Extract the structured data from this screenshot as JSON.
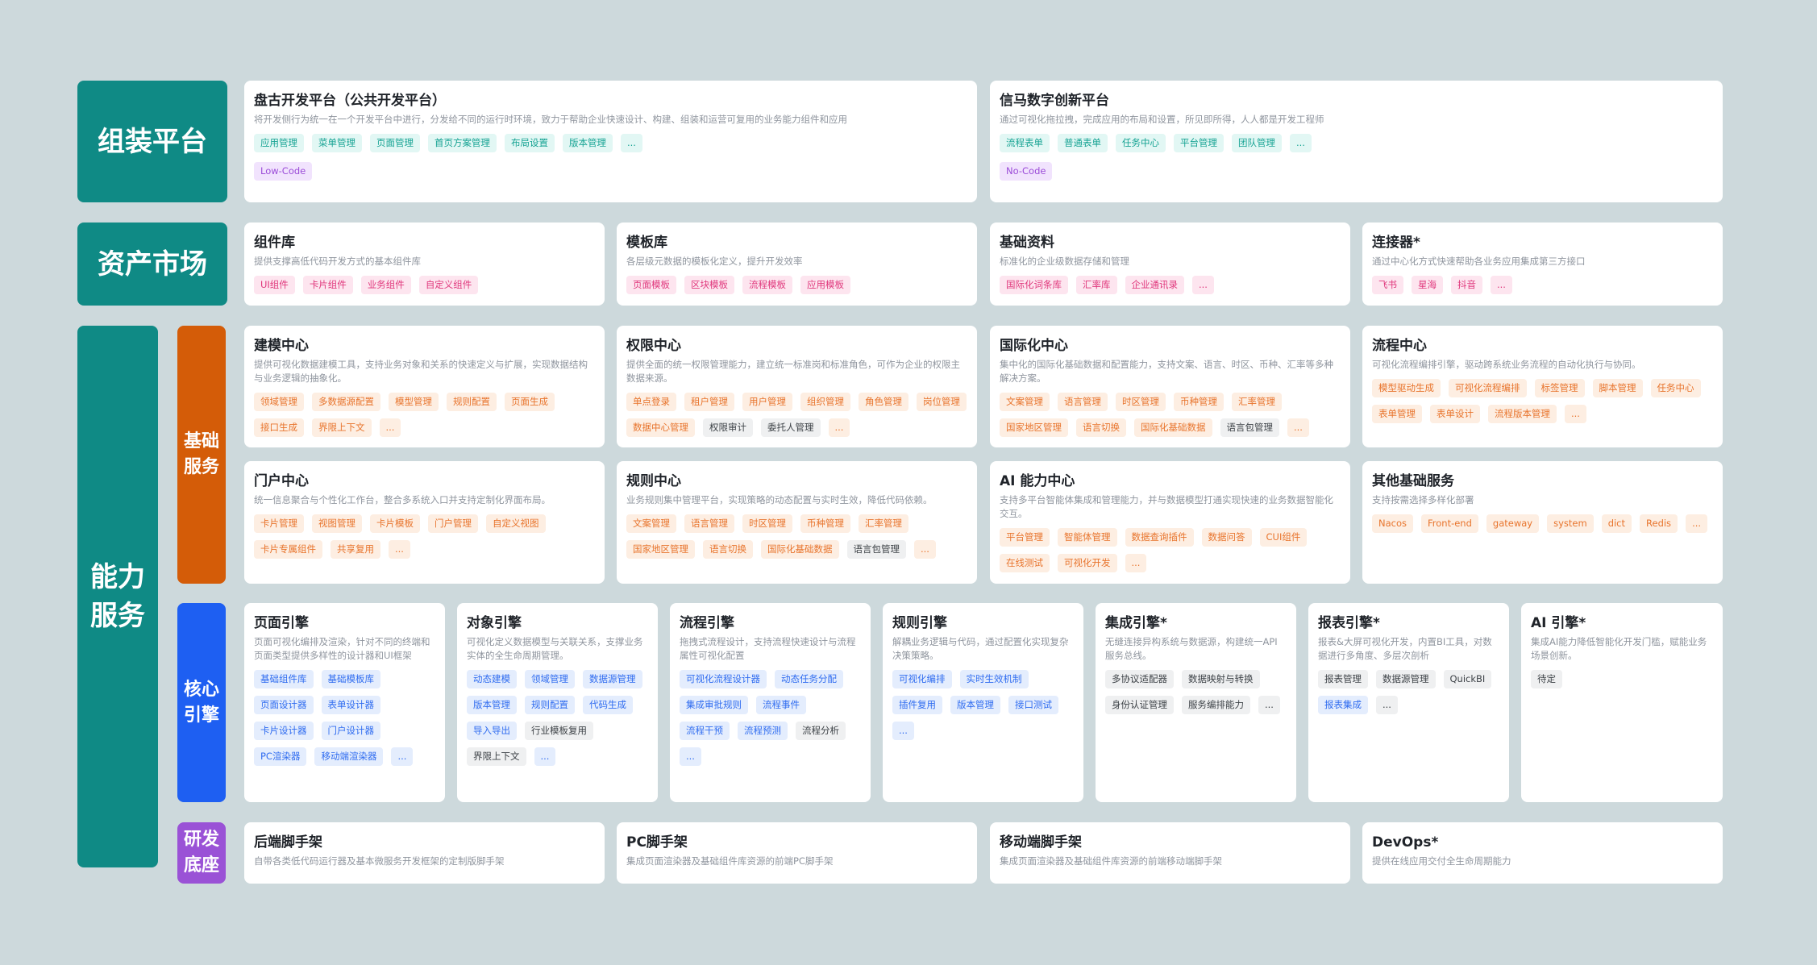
{
  "colors": {
    "teal": "#0f8a85",
    "orange": "#d45c08",
    "blue": "#1e5ff2",
    "purple": "#9a52d6",
    "background": "#cdd9dc"
  },
  "sections": {
    "assembly": "组装平台",
    "assets": "资产市场",
    "capability": "能力\n服务",
    "basic": "基础\n服务",
    "core": "核心\n引擎",
    "foundation": "研发\n底座"
  },
  "cards": {
    "pangu": {
      "title": "盘古开发平台（公共开发平台）",
      "desc": "将开发侧行为统一在一个开发平台中进行，分发给不同的运行时环境，致力于帮助企业快速设计、构建、组装和运营可复用的业务能力组件和应用",
      "tags": [
        {
          "text": "应用管理",
          "c": "teal"
        },
        {
          "text": "菜单管理",
          "c": "teal"
        },
        {
          "text": "页面管理",
          "c": "teal"
        },
        {
          "text": "首页方案管理",
          "c": "teal"
        },
        {
          "text": "布局设置",
          "c": "teal"
        },
        {
          "text": "版本管理",
          "c": "teal"
        },
        {
          "text": "...",
          "c": "teal"
        }
      ],
      "tags2": [
        {
          "text": "Low-Code",
          "c": "purple"
        }
      ]
    },
    "xinma": {
      "title": "信马数字创新平台",
      "desc": "通过可视化拖拉拽，完成应用的布局和设置，所见即所得，人人都是开发工程师",
      "tags": [
        {
          "text": "流程表单",
          "c": "teal"
        },
        {
          "text": "普通表单",
          "c": "teal"
        },
        {
          "text": "任务中心",
          "c": "teal"
        },
        {
          "text": "平台管理",
          "c": "teal"
        },
        {
          "text": "团队管理",
          "c": "teal"
        },
        {
          "text": "...",
          "c": "teal"
        }
      ],
      "tags2": [
        {
          "text": "No-Code",
          "c": "purple"
        }
      ]
    },
    "component": {
      "title": "组件库",
      "desc": "提供支撑高低代码开发方式的基本组件库",
      "tags": [
        {
          "text": "UI组件",
          "c": "pink"
        },
        {
          "text": "卡片组件",
          "c": "pink"
        },
        {
          "text": "业务组件",
          "c": "pink"
        },
        {
          "text": "自定义组件",
          "c": "pink"
        }
      ]
    },
    "template": {
      "title": "模板库",
      "desc": "各层级元数据的模板化定义，提升开发效率",
      "tags": [
        {
          "text": "页面模板",
          "c": "pink"
        },
        {
          "text": "区块模板",
          "c": "pink"
        },
        {
          "text": "流程模板",
          "c": "pink"
        },
        {
          "text": "应用模板",
          "c": "pink"
        }
      ]
    },
    "basedata": {
      "title": "基础资料",
      "desc": "标准化的企业级数据存储和管理",
      "tags": [
        {
          "text": "国际化词条库",
          "c": "pink"
        },
        {
          "text": "汇率库",
          "c": "pink"
        },
        {
          "text": "企业通讯录",
          "c": "pink"
        },
        {
          "text": "...",
          "c": "pink"
        }
      ]
    },
    "connector": {
      "title": "连接器*",
      "desc": "通过中心化方式快速帮助各业务应用集成第三方接口",
      "tags": [
        {
          "text": "飞书",
          "c": "pink"
        },
        {
          "text": "星海",
          "c": "pink"
        },
        {
          "text": "抖音",
          "c": "pink"
        },
        {
          "text": "...",
          "c": "pink"
        }
      ]
    },
    "modeling": {
      "title": "建模中心",
      "desc": "提供可视化数据建模工具，支持业务对象和关系的快速定义与扩展，实现数据结构与业务逻辑的抽象化。",
      "tags": [
        {
          "text": "领域管理",
          "c": "orange"
        },
        {
          "text": "多数据源配置",
          "c": "orange"
        },
        {
          "text": "模型管理",
          "c": "orange"
        },
        {
          "text": "规则配置",
          "c": "orange"
        },
        {
          "text": "页面生成",
          "c": "orange"
        },
        {
          "text": "接口生成",
          "c": "orange"
        },
        {
          "text": "界限上下文",
          "c": "orange"
        },
        {
          "text": "...",
          "c": "orange"
        }
      ]
    },
    "permission": {
      "title": "权限中心",
      "desc": "提供全面的统一权限管理能力，建立统一标准岗和标准角色，可作为企业的权限主数据来源。",
      "tags": [
        {
          "text": "单点登录",
          "c": "orange"
        },
        {
          "text": "租户管理",
          "c": "orange"
        },
        {
          "text": "用户管理",
          "c": "orange"
        },
        {
          "text": "组织管理",
          "c": "orange"
        },
        {
          "text": "角色管理",
          "c": "orange"
        },
        {
          "text": "岗位管理",
          "c": "orange"
        },
        {
          "text": "数据中心管理",
          "c": "orange"
        },
        {
          "text": "权限审计",
          "c": "gray"
        },
        {
          "text": "委托人管理",
          "c": "gray"
        },
        {
          "text": "...",
          "c": "orange"
        }
      ]
    },
    "i18n": {
      "title": "国际化中心",
      "desc": "集中化的国际化基础数据和配置能力，支持文案、语言、时区、币种、汇率等多种解决方案。",
      "tags": [
        {
          "text": "文案管理",
          "c": "orange"
        },
        {
          "text": "语言管理",
          "c": "orange"
        },
        {
          "text": "时区管理",
          "c": "orange"
        },
        {
          "text": "币种管理",
          "c": "orange"
        },
        {
          "text": "汇率管理",
          "c": "orange"
        },
        {
          "text": "国家地区管理",
          "c": "orange"
        },
        {
          "text": "语言切换",
          "c": "orange"
        },
        {
          "text": "国际化基础数据",
          "c": "orange"
        },
        {
          "text": "语言包管理",
          "c": "gray"
        },
        {
          "text": "...",
          "c": "orange"
        }
      ]
    },
    "process": {
      "title": "流程中心",
      "desc": "可视化流程编排引擎，驱动跨系统业务流程的自动化执行与协同。",
      "tags": [
        {
          "text": "模型驱动生成",
          "c": "orange"
        },
        {
          "text": "可视化流程编排",
          "c": "orange"
        },
        {
          "text": "标签管理",
          "c": "orange"
        },
        {
          "text": "脚本管理",
          "c": "orange"
        },
        {
          "text": "任务中心",
          "c": "orange"
        },
        {
          "text": "表单管理",
          "c": "orange"
        },
        {
          "text": "表单设计",
          "c": "orange"
        },
        {
          "text": "流程版本管理",
          "c": "orange"
        },
        {
          "text": "...",
          "c": "orange"
        }
      ]
    },
    "portal": {
      "title": "门户中心",
      "desc": "统一信息聚合与个性化工作台，整合多系统入口并支持定制化界面布局。",
      "tags": [
        {
          "text": "卡片管理",
          "c": "orange"
        },
        {
          "text": "视图管理",
          "c": "orange"
        },
        {
          "text": "卡片模板",
          "c": "orange"
        },
        {
          "text": "门户管理",
          "c": "orange"
        },
        {
          "text": "自定义视图",
          "c": "orange"
        },
        {
          "text": "卡片专属组件",
          "c": "orange"
        },
        {
          "text": "共享复用",
          "c": "orange"
        },
        {
          "text": "...",
          "c": "orange"
        }
      ]
    },
    "rules": {
      "title": "规则中心",
      "desc": "业务规则集中管理平台，实现策略的动态配置与实时生效，降低代码依赖。",
      "tags": [
        {
          "text": "文案管理",
          "c": "orange"
        },
        {
          "text": "语言管理",
          "c": "orange"
        },
        {
          "text": "时区管理",
          "c": "orange"
        },
        {
          "text": "币种管理",
          "c": "orange"
        },
        {
          "text": "汇率管理",
          "c": "orange"
        },
        {
          "text": "国家地区管理",
          "c": "orange"
        },
        {
          "text": "语言切换",
          "c": "orange"
        },
        {
          "text": "国际化基础数据",
          "c": "orange"
        },
        {
          "text": "语言包管理",
          "c": "gray"
        },
        {
          "text": "...",
          "c": "orange"
        }
      ]
    },
    "ai": {
      "title": "AI 能力中心",
      "desc": "支持多平台智能体集成和管理能力，并与数据模型打通实现快速的业务数据智能化交互。",
      "tags": [
        {
          "text": "平台管理",
          "c": "orange"
        },
        {
          "text": "智能体管理",
          "c": "orange"
        },
        {
          "text": "数据查询插件",
          "c": "orange"
        },
        {
          "text": "数据问答",
          "c": "orange"
        },
        {
          "text": "CUI组件",
          "c": "orange"
        },
        {
          "text": "在线测试",
          "c": "orange"
        },
        {
          "text": "可视化开发",
          "c": "orange"
        },
        {
          "text": "...",
          "c": "orange"
        }
      ]
    },
    "otherbasic": {
      "title": "其他基础服务",
      "desc": "支持按需选择多样化部署",
      "tags": [
        {
          "text": "Nacos",
          "c": "orange"
        },
        {
          "text": "Front-end",
          "c": "orange"
        },
        {
          "text": "gateway",
          "c": "orange"
        },
        {
          "text": "system",
          "c": "orange"
        },
        {
          "text": "dict",
          "c": "orange"
        },
        {
          "text": "Redis",
          "c": "orange"
        },
        {
          "text": "...",
          "c": "orange"
        }
      ]
    },
    "pageengine": {
      "title": "页面引擎",
      "desc": "页面可视化编排及渲染，针对不同的终端和页面类型提供多样性的设计器和UI框架",
      "tags": [
        {
          "text": "基础组件库",
          "c": "blue"
        },
        {
          "text": "基础模板库",
          "c": "blue"
        },
        {
          "text": "页面设计器",
          "c": "blue"
        },
        {
          "text": "表单设计器",
          "c": "blue"
        },
        {
          "text": "卡片设计器",
          "c": "blue"
        },
        {
          "text": "门户设计器",
          "c": "blue"
        },
        {
          "text": "PC渲染器",
          "c": "blue"
        },
        {
          "text": "移动端渲染器",
          "c": "blue"
        },
        {
          "text": "...",
          "c": "blue"
        }
      ]
    },
    "objectengine": {
      "title": "对象引擎",
      "desc": "可视化定义数据模型与关联关系，支撑业务实体的全生命周期管理。",
      "tags": [
        {
          "text": "动态建模",
          "c": "blue"
        },
        {
          "text": "领域管理",
          "c": "blue"
        },
        {
          "text": "数据源管理",
          "c": "blue"
        },
        {
          "text": "版本管理",
          "c": "blue"
        },
        {
          "text": "规则配置",
          "c": "blue"
        },
        {
          "text": "代码生成",
          "c": "blue"
        },
        {
          "text": "导入导出",
          "c": "blue"
        },
        {
          "text": "行业模板复用",
          "c": "gray"
        },
        {
          "text": "界限上下文",
          "c": "gray"
        },
        {
          "text": "...",
          "c": "blue"
        }
      ]
    },
    "flowengine": {
      "title": "流程引擎",
      "desc": "拖拽式流程设计，支持流程快速设计与流程属性可视化配置",
      "tags": [
        {
          "text": "可视化流程设计器",
          "c": "blue"
        },
        {
          "text": "动态任务分配",
          "c": "blue"
        },
        {
          "text": "集成审批规则",
          "c": "blue"
        },
        {
          "text": "流程事件",
          "c": "blue"
        },
        {
          "text": "流程干预",
          "c": "blue"
        },
        {
          "text": "流程预测",
          "c": "blue"
        },
        {
          "text": "流程分析",
          "c": "gray"
        },
        {
          "text": "...",
          "c": "blue"
        }
      ]
    },
    "ruleengine": {
      "title": "规则引擎",
      "desc": "解耦业务逻辑与代码，通过配置化实现复杂决策策略。",
      "tags": [
        {
          "text": "可视化编排",
          "c": "blue"
        },
        {
          "text": "实时生效机制",
          "c": "blue"
        },
        {
          "text": "插件复用",
          "c": "blue"
        },
        {
          "text": "版本管理",
          "c": "blue"
        },
        {
          "text": "接口测试",
          "c": "blue"
        },
        {
          "text": "...",
          "c": "blue"
        }
      ]
    },
    "integrationengine": {
      "title": "集成引擎*",
      "desc": "无缝连接异构系统与数据源，构建统一API服务总线。",
      "tags": [
        {
          "text": "多协议适配器",
          "c": "gray"
        },
        {
          "text": "数据映射与转换",
          "c": "gray"
        },
        {
          "text": "身份认证管理",
          "c": "gray"
        },
        {
          "text": "服务编排能力",
          "c": "gray"
        },
        {
          "text": "...",
          "c": "gray"
        }
      ]
    },
    "reportengine": {
      "title": "报表引擎*",
      "desc": "报表&大屏可视化开发，内置BI工具，对数据进行多角度、多层次剖析",
      "tags": [
        {
          "text": "报表管理",
          "c": "gray"
        },
        {
          "text": "数据源管理",
          "c": "gray"
        },
        {
          "text": "QuickBI",
          "c": "gray"
        },
        {
          "text": "报表集成",
          "c": "blue"
        },
        {
          "text": "...",
          "c": "gray"
        }
      ]
    },
    "aiengine": {
      "title": "AI 引擎*",
      "desc": "集成AI能力降低智能化开发门槛，赋能业务场景创新。",
      "tags": [
        {
          "text": "待定",
          "c": "gray"
        }
      ]
    },
    "backend": {
      "title": "后端脚手架",
      "desc": "自带各类低代码运行器及基本微服务开发框架的定制版脚手架",
      "tags": []
    },
    "pc": {
      "title": "PC脚手架",
      "desc": "集成页面渲染器及基础组件库资源的前端PC脚手架",
      "tags": []
    },
    "mobile": {
      "title": "移动端脚手架",
      "desc": "集成页面渲染器及基础组件库资源的前端移动端脚手架",
      "tags": []
    },
    "devops": {
      "title": "DevOps*",
      "desc": "提供在线应用交付全生命周期能力",
      "tags": []
    }
  }
}
